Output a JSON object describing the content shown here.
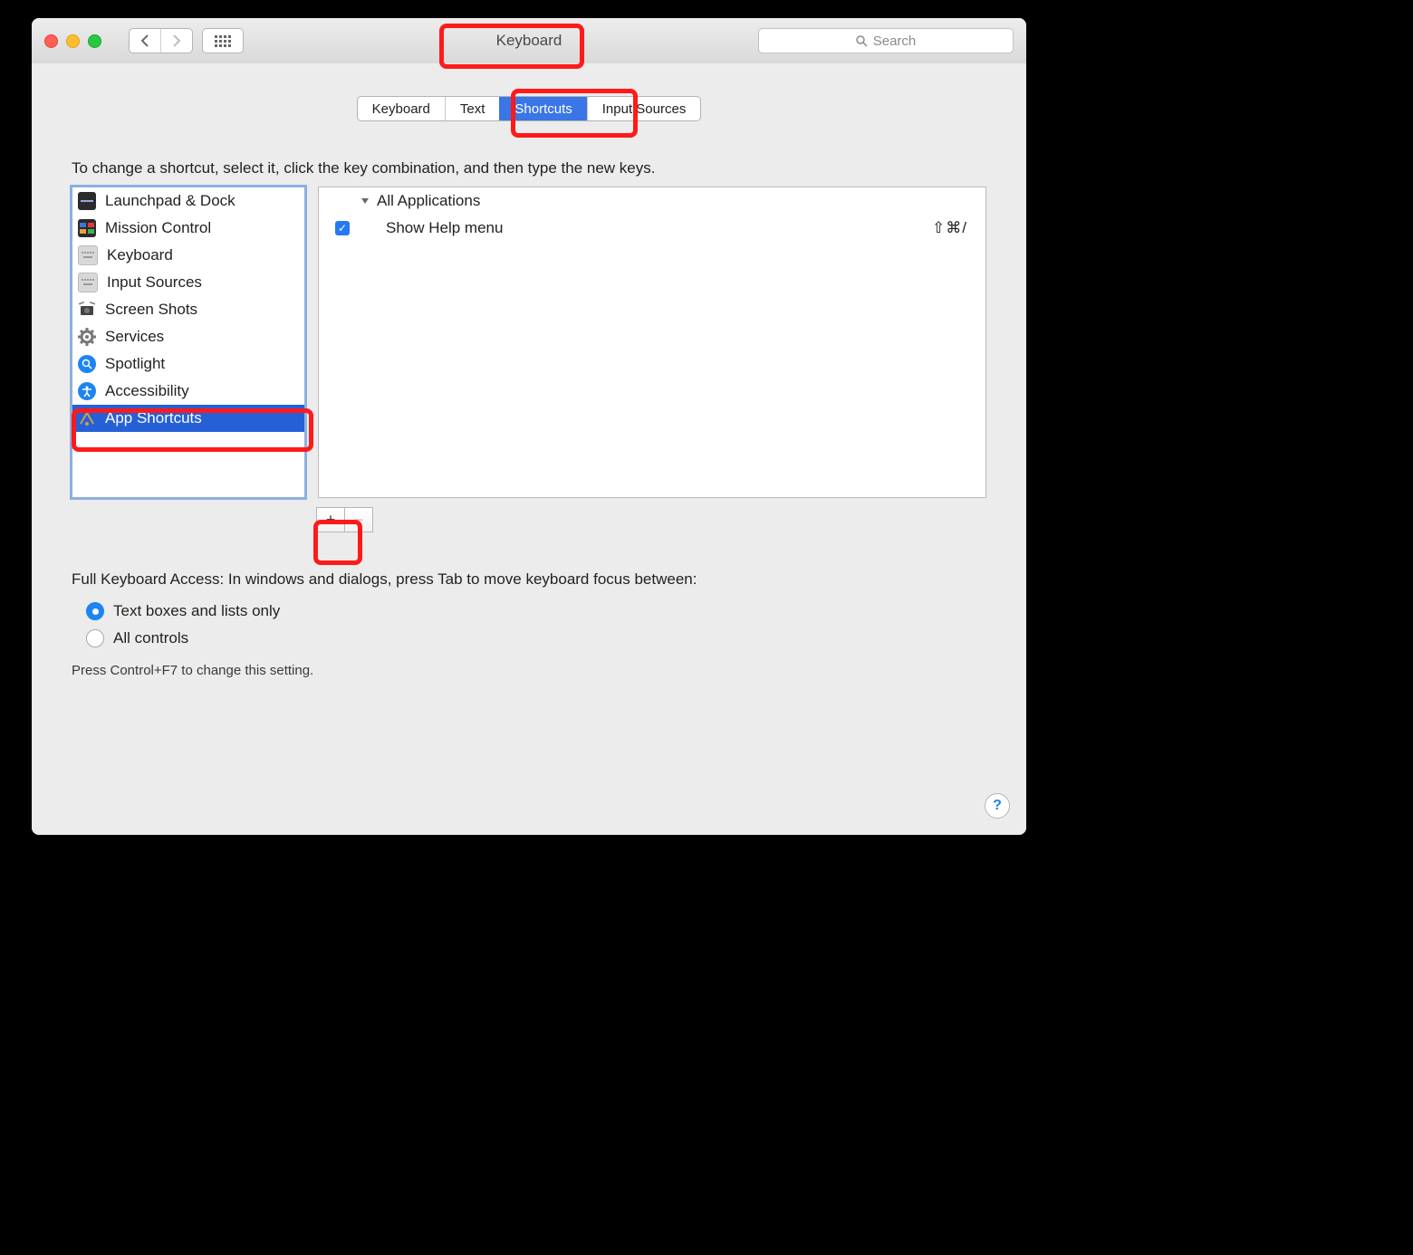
{
  "window": {
    "title": "Keyboard"
  },
  "toolbar": {
    "search_placeholder": "Search"
  },
  "tabs": [
    {
      "label": "Keyboard",
      "active": false
    },
    {
      "label": "Text",
      "active": false
    },
    {
      "label": "Shortcuts",
      "active": true
    },
    {
      "label": "Input Sources",
      "active": false
    }
  ],
  "instruction": "To change a shortcut, select it, click the key combination, and then type the new keys.",
  "categories": [
    {
      "label": "Launchpad & Dock",
      "icon": "launchpad",
      "selected": false
    },
    {
      "label": "Mission Control",
      "icon": "mission",
      "selected": false
    },
    {
      "label": "Keyboard",
      "icon": "keyboard",
      "selected": false
    },
    {
      "label": "Input Sources",
      "icon": "keyboard",
      "selected": false
    },
    {
      "label": "Screen Shots",
      "icon": "screenshot",
      "selected": false
    },
    {
      "label": "Services",
      "icon": "services",
      "selected": false
    },
    {
      "label": "Spotlight",
      "icon": "spotlight",
      "selected": false
    },
    {
      "label": "Accessibility",
      "icon": "accessibility",
      "selected": false
    },
    {
      "label": "App Shortcuts",
      "icon": "app",
      "selected": true
    }
  ],
  "shortcut_group": {
    "title": "All Applications"
  },
  "shortcuts": [
    {
      "enabled": true,
      "label": "Show Help menu",
      "keys": "⇧⌘/"
    }
  ],
  "buttons": {
    "add": "+",
    "remove": "−"
  },
  "fka": {
    "heading": "Full Keyboard Access: In windows and dialogs, press Tab to move keyboard focus between:",
    "options": [
      {
        "label": "Text boxes and lists only",
        "selected": true
      },
      {
        "label": "All controls",
        "selected": false
      }
    ],
    "hint": "Press Control+F7 to change this setting."
  },
  "help": "?"
}
